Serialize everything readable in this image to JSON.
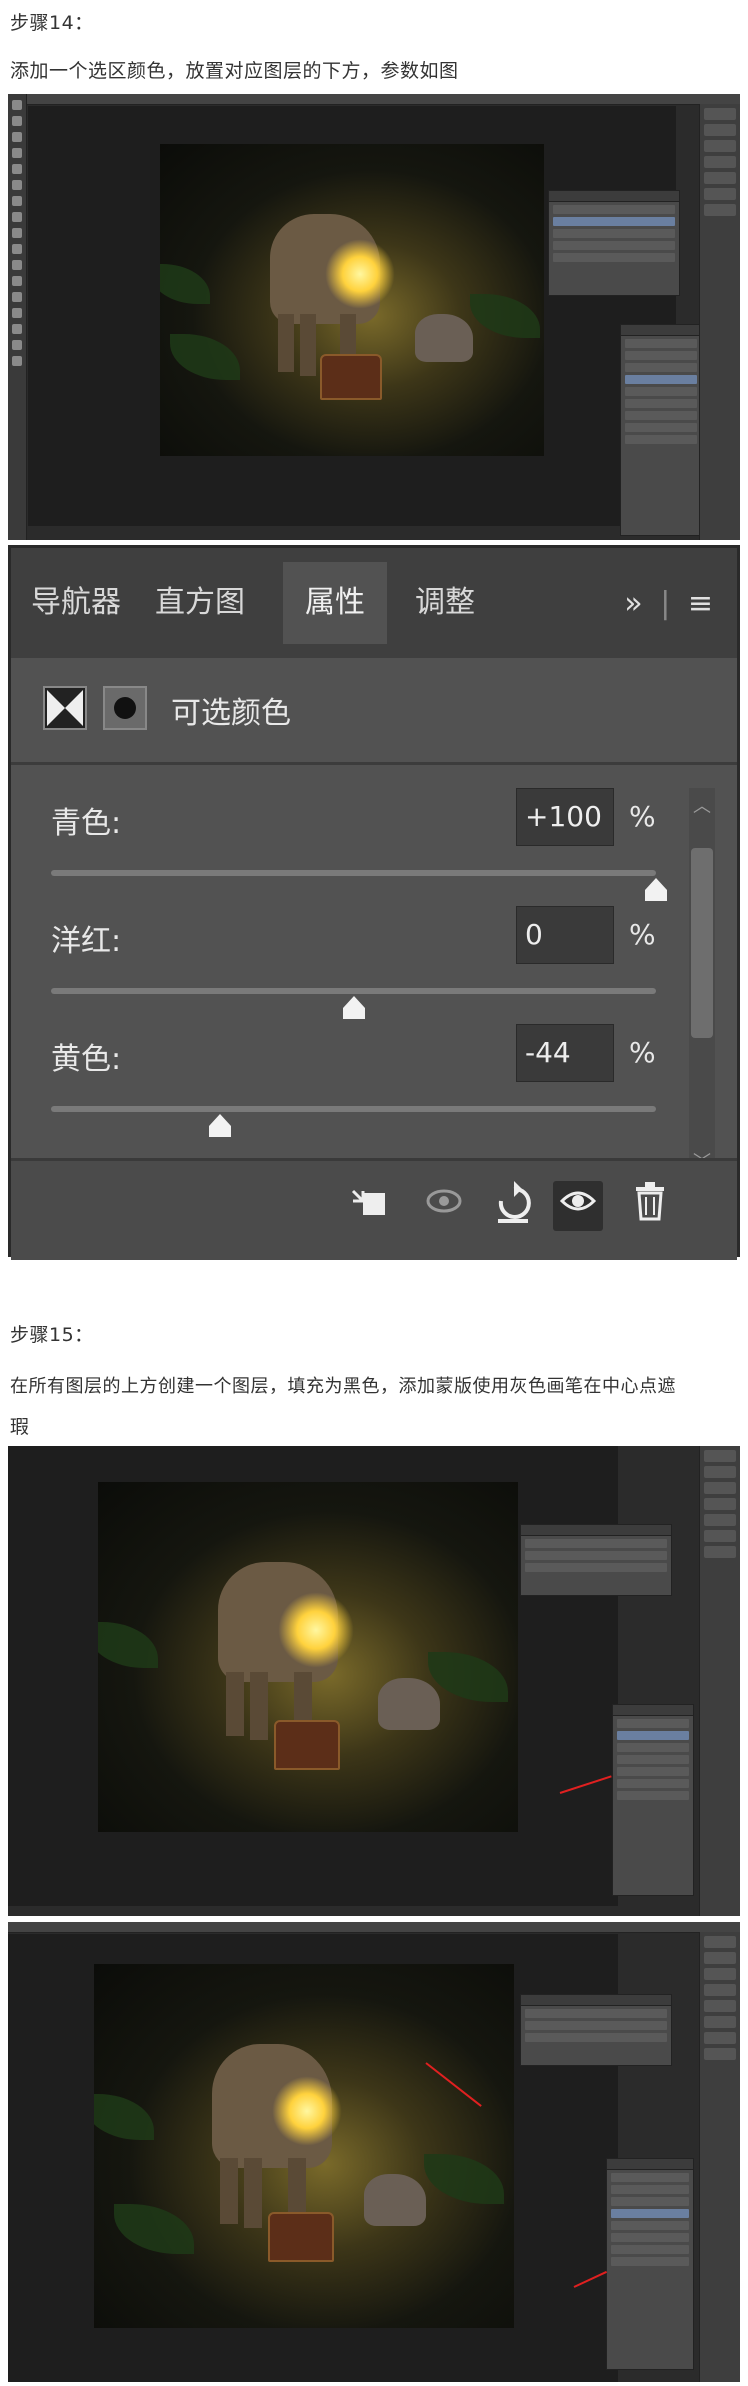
{
  "step14": {
    "heading": "步骤14：",
    "instruction": "添加一个选区颜色，放置对应图层的下方，参数如图"
  },
  "properties_panel": {
    "tabs": [
      "导航器",
      "直方图",
      "属性",
      "调整"
    ],
    "active_tab": "属性",
    "expand_label": "»",
    "menu_icon": "hamburger-menu-icon",
    "title": "可选颜色",
    "sliders": [
      {
        "label": "青色:",
        "value": "+100",
        "unit": "%",
        "fraction": 1.0
      },
      {
        "label": "洋红:",
        "value": "0",
        "unit": "%",
        "fraction": 0.5
      },
      {
        "label": "黄色:",
        "value": "-44",
        "unit": "%",
        "fraction": 0.28
      }
    ],
    "footer_icons": [
      "clip-to-layer-icon",
      "view-previous-state-icon",
      "reset-icon",
      "visibility-eye-icon",
      "trash-icon"
    ]
  },
  "step15": {
    "heading": "步骤15：",
    "instruction_line1": "在所有图层的上方创建一个图层，填充为黑色，添加蒙版使用灰色画笔在中心点遮",
    "instruction_line2": "瑕"
  },
  "colors": {
    "annotation_arrow": "#e02020",
    "lantern_glow": "#ffd23d"
  }
}
